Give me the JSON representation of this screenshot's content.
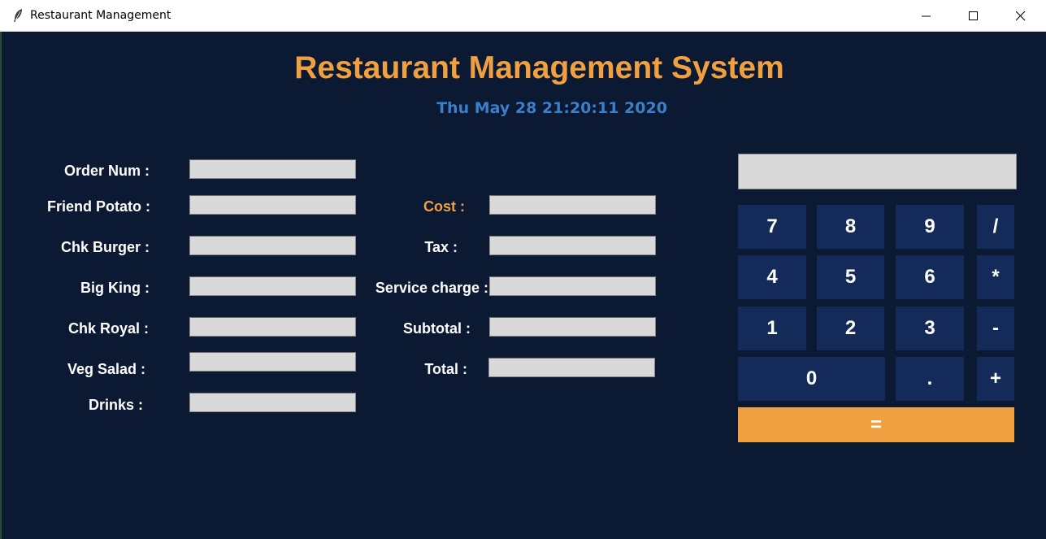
{
  "window": {
    "title": "Restaurant Management",
    "app_icon": "feather-icon",
    "controls": [
      "minimize-icon",
      "maximize-icon",
      "close-icon"
    ]
  },
  "header": {
    "title": "Restaurant Management System",
    "datetime": "Thu May 28 21:20:11 2020"
  },
  "colors": {
    "background": "#0b1933",
    "accent": "#f0a040",
    "date": "#3d7ec9",
    "key": "#142b5a",
    "field": "#d9d9d9"
  },
  "order_form": {
    "order_num": {
      "label": "Order Num :",
      "value": ""
    },
    "friend_potato": {
      "label": "Friend Potato :",
      "value": ""
    },
    "chk_burger": {
      "label": "Chk Burger :",
      "value": ""
    },
    "big_king": {
      "label": "Big King :",
      "value": ""
    },
    "chk_royal": {
      "label": "Chk Royal :",
      "value": ""
    },
    "veg_salad": {
      "label": "Veg Salad :",
      "value": ""
    },
    "drinks": {
      "label": "Drinks :",
      "value": ""
    }
  },
  "bill": {
    "cost": {
      "label": "Cost :",
      "value": ""
    },
    "tax": {
      "label": "Tax :",
      "value": ""
    },
    "service_charge": {
      "label": "Service charge :",
      "value": ""
    },
    "subtotal": {
      "label": "Subtotal :",
      "value": ""
    },
    "total": {
      "label": "Total :",
      "value": ""
    }
  },
  "calculator": {
    "display": "",
    "keys": {
      "k7": "7",
      "k8": "8",
      "k9": "9",
      "div": "/",
      "k4": "4",
      "k5": "5",
      "k6": "6",
      "mul": "*",
      "k1": "1",
      "k2": "2",
      "k3": "3",
      "sub": "-",
      "k0": "0",
      "dot": ".",
      "add": "+",
      "equals": "="
    }
  }
}
